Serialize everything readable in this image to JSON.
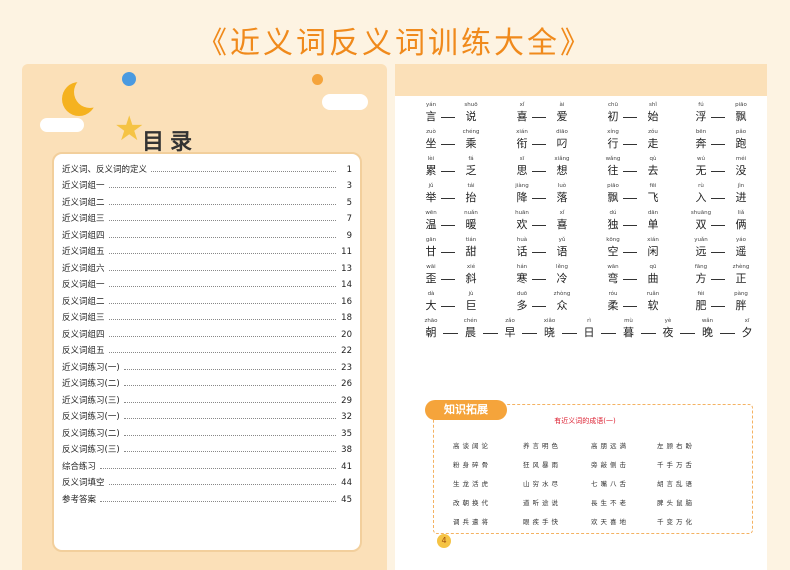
{
  "page_title": "《近义词反义词训练大全》",
  "toc": {
    "heading": "目录",
    "items": [
      {
        "label": "近义词、反义词的定义",
        "page": "1"
      },
      {
        "label": "近义词组一",
        "page": "3"
      },
      {
        "label": "近义词组二",
        "page": "5"
      },
      {
        "label": "近义词组三",
        "page": "7"
      },
      {
        "label": "近义词组四",
        "page": "9"
      },
      {
        "label": "近义词组五",
        "page": "11"
      },
      {
        "label": "近义词组六",
        "page": "13"
      },
      {
        "label": "反义词组一",
        "page": "14"
      },
      {
        "label": "反义词组二",
        "page": "16"
      },
      {
        "label": "反义词组三",
        "page": "18"
      },
      {
        "label": "反义词组四",
        "page": "20"
      },
      {
        "label": "反义词组五",
        "page": "22"
      },
      {
        "label": "近义词练习(一)",
        "page": "23"
      },
      {
        "label": "近义词练习(二)",
        "page": "26"
      },
      {
        "label": "近义词练习(三)",
        "page": "29"
      },
      {
        "label": "反义词练习(一)",
        "page": "32"
      },
      {
        "label": "反义词练习(二)",
        "page": "35"
      },
      {
        "label": "反义词练习(三)",
        "page": "38"
      },
      {
        "label": "综合练习",
        "page": "41"
      },
      {
        "label": "反义词填空",
        "page": "44"
      },
      {
        "label": "参考答案",
        "page": "45"
      }
    ]
  },
  "word_pairs": [
    [
      {
        "a": "言",
        "a_py": "yán",
        "b": "说",
        "b_py": "shuō"
      },
      {
        "a": "喜",
        "a_py": "xǐ",
        "b": "爱",
        "b_py": "ài"
      },
      {
        "a": "初",
        "a_py": "chū",
        "b": "始",
        "b_py": "shǐ"
      },
      {
        "a": "浮",
        "a_py": "fú",
        "b": "飘",
        "b_py": "piāo"
      }
    ],
    [
      {
        "a": "坐",
        "a_py": "zuò",
        "b": "乘",
        "b_py": "chéng"
      },
      {
        "a": "衔",
        "a_py": "xián",
        "b": "叼",
        "b_py": "diāo"
      },
      {
        "a": "行",
        "a_py": "xíng",
        "b": "走",
        "b_py": "zǒu"
      },
      {
        "a": "奔",
        "a_py": "bēn",
        "b": "跑",
        "b_py": "pǎo"
      }
    ],
    [
      {
        "a": "累",
        "a_py": "lèi",
        "b": "乏",
        "b_py": "fá"
      },
      {
        "a": "思",
        "a_py": "sī",
        "b": "想",
        "b_py": "xiǎng"
      },
      {
        "a": "往",
        "a_py": "wǎng",
        "b": "去",
        "b_py": "qù"
      },
      {
        "a": "无",
        "a_py": "wú",
        "b": "没",
        "b_py": "méi"
      }
    ],
    [
      {
        "a": "举",
        "a_py": "jǔ",
        "b": "抬",
        "b_py": "tái"
      },
      {
        "a": "降",
        "a_py": "jiàng",
        "b": "落",
        "b_py": "luò"
      },
      {
        "a": "飘",
        "a_py": "piāo",
        "b": "飞",
        "b_py": "fēi"
      },
      {
        "a": "入",
        "a_py": "rù",
        "b": "进",
        "b_py": "jìn"
      }
    ],
    [
      {
        "a": "温",
        "a_py": "wēn",
        "b": "暖",
        "b_py": "nuǎn"
      },
      {
        "a": "欢",
        "a_py": "huān",
        "b": "喜",
        "b_py": "xǐ"
      },
      {
        "a": "独",
        "a_py": "dú",
        "b": "单",
        "b_py": "dān"
      },
      {
        "a": "双",
        "a_py": "shuāng",
        "b": "俩",
        "b_py": "liǎ"
      }
    ],
    [
      {
        "a": "甘",
        "a_py": "gān",
        "b": "甜",
        "b_py": "tián"
      },
      {
        "a": "话",
        "a_py": "huà",
        "b": "语",
        "b_py": "yǔ"
      },
      {
        "a": "空",
        "a_py": "kōng",
        "b": "闲",
        "b_py": "xián"
      },
      {
        "a": "远",
        "a_py": "yuǎn",
        "b": "遥",
        "b_py": "yáo"
      }
    ],
    [
      {
        "a": "歪",
        "a_py": "wāi",
        "b": "斜",
        "b_py": "xié"
      },
      {
        "a": "寒",
        "a_py": "hán",
        "b": "冷",
        "b_py": "lěng"
      },
      {
        "a": "弯",
        "a_py": "wān",
        "b": "曲",
        "b_py": "qū"
      },
      {
        "a": "方",
        "a_py": "fāng",
        "b": "正",
        "b_py": "zhèng"
      }
    ],
    [
      {
        "a": "大",
        "a_py": "dà",
        "b": "巨",
        "b_py": "jù"
      },
      {
        "a": "多",
        "a_py": "duō",
        "b": "众",
        "b_py": "zhòng"
      },
      {
        "a": "柔",
        "a_py": "róu",
        "b": "软",
        "b_py": "ruǎn"
      },
      {
        "a": "肥",
        "a_py": "féi",
        "b": "胖",
        "b_py": "pàng"
      }
    ]
  ],
  "chain_row": [
    {
      "c": "朝",
      "py": "zhāo"
    },
    {
      "c": "晨",
      "py": "chén"
    },
    {
      "c": "早",
      "py": "zǎo"
    },
    {
      "c": "晓",
      "py": "xiǎo"
    },
    {
      "c": "日",
      "py": "rì"
    },
    {
      "c": "暮",
      "py": "mù"
    },
    {
      "c": "夜",
      "py": "yè"
    },
    {
      "c": "晚",
      "py": "wǎn"
    },
    {
      "c": "夕",
      "py": "xī"
    }
  ],
  "extension": {
    "badge": "知识拓展",
    "title": "有近义词的成语(一)",
    "idioms": [
      [
        "高谈阔论",
        "养言明色",
        "高朋远满",
        "左顾右盼"
      ],
      [
        "粉身碎骨",
        "狂风暴雨",
        "旁敲侧击",
        "千手万舌"
      ],
      [
        "生龙活虎",
        "山穷水尽",
        "七嘴八舌",
        "胡言乱语"
      ],
      [
        "改朝换代",
        "道听途说",
        "長生不老",
        "脾头鼠脑"
      ],
      [
        "调兵遣将",
        "眼疾手快",
        "欢天喜地",
        "千变万化"
      ]
    ]
  },
  "page_number": "4",
  "colors": {
    "title": "#f08a1c",
    "accent": "#f5a43b",
    "panel": "#fbe0b8"
  }
}
